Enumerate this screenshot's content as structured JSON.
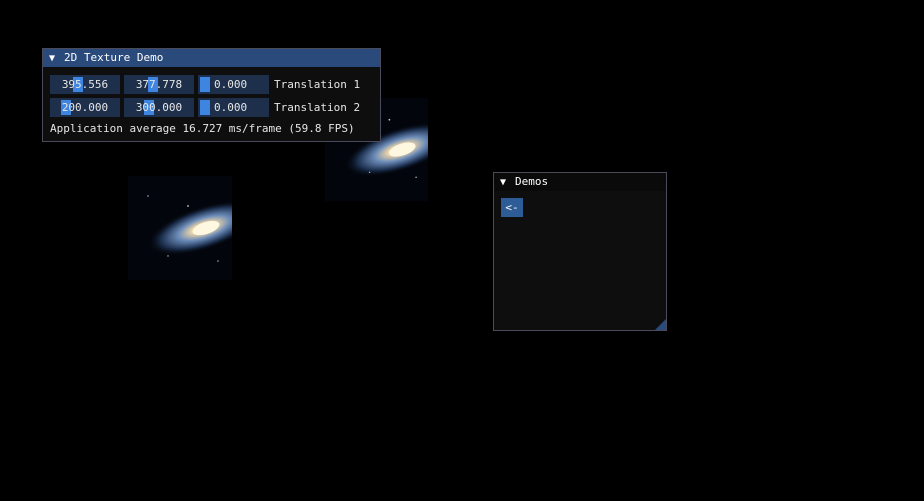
{
  "texture_window": {
    "title": "2D Texture Demo",
    "translation_1": {
      "x": "395.556",
      "y": "377.778",
      "z": "0.000",
      "label": "Translation 1"
    },
    "translation_2": {
      "x": "200.000",
      "y": "300.000",
      "z": "0.000",
      "label": "Translation 2"
    },
    "status_text": "Application average 16.727 ms/frame (59.8 FPS)"
  },
  "demos_window": {
    "title": "Demos",
    "back_label": "<-"
  },
  "colors": {
    "title_active": "#294a7a",
    "frame_bg": "#1d2f4a",
    "grab": "#3d85e0",
    "button": "#2d5c96"
  },
  "icons": {
    "collapse": "triangle-down-icon",
    "resize": "resize-grip-icon"
  }
}
